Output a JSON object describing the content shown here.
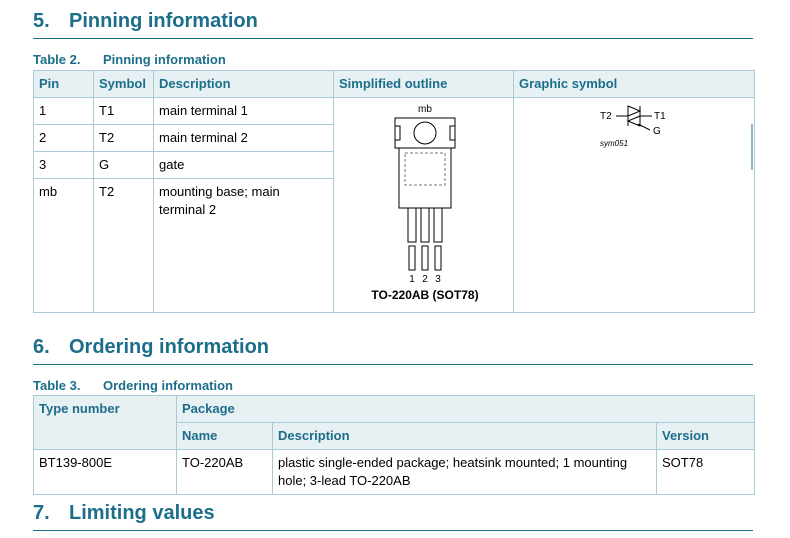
{
  "sec5": {
    "num": "5.",
    "title": "Pinning information"
  },
  "table2": {
    "label": "Table 2.",
    "title": "Pinning information",
    "headers": [
      "Pin",
      "Symbol",
      "Description",
      "Simplified outline",
      "Graphic symbol"
    ],
    "rows": [
      {
        "pin": "1",
        "symbol": "T1",
        "description": "main terminal 1"
      },
      {
        "pin": "2",
        "symbol": "T2",
        "description": "main terminal 2"
      },
      {
        "pin": "3",
        "symbol": "G",
        "description": "gate"
      },
      {
        "pin": "mb",
        "symbol": "T2",
        "description": "mounting base; main terminal 2"
      }
    ],
    "outline": {
      "mb": "mb",
      "pins": [
        "1",
        "2",
        "3"
      ],
      "package": "TO-220AB (SOT78)"
    },
    "symbol": {
      "t2": "T2",
      "t1": "T1",
      "g": "G",
      "ref": "sym051"
    }
  },
  "sec6": {
    "num": "6.",
    "title": "Ordering information"
  },
  "table3": {
    "label": "Table 3.",
    "title": "Ordering information",
    "headers": {
      "type_number": "Type number",
      "package": "Package",
      "name": "Name",
      "description": "Description",
      "version": "Version"
    },
    "row": {
      "type_number": "BT139-800E",
      "name": "TO-220AB",
      "description": "plastic single-ended package; heatsink mounted; 1 mounting hole; 3-lead TO-220AB",
      "version": "SOT78"
    }
  },
  "sec7": {
    "num": "7.",
    "title": "Limiting values"
  }
}
